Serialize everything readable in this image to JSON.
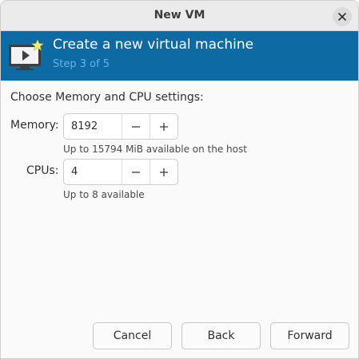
{
  "window": {
    "title": "New VM"
  },
  "header": {
    "title": "Create a new virtual machine",
    "step": "Step 3 of 5"
  },
  "content": {
    "section_label": "Choose Memory and CPU settings:",
    "memory": {
      "label": "Memory:",
      "value": "8192",
      "hint": "Up to 15794 MiB available on the host"
    },
    "cpus": {
      "label": "CPUs:",
      "value": "4",
      "hint": "Up to 8 available"
    }
  },
  "footer": {
    "cancel_label": "Cancel",
    "back_label": "Back",
    "forward_label": "Forward"
  },
  "colors": {
    "header_bg": "#0d6aa3",
    "step_text": "#66b3e6"
  },
  "icons": {
    "close": "close-icon",
    "logo": "vm-monitor-icon",
    "decrement": "minus-icon",
    "increment": "plus-icon"
  }
}
